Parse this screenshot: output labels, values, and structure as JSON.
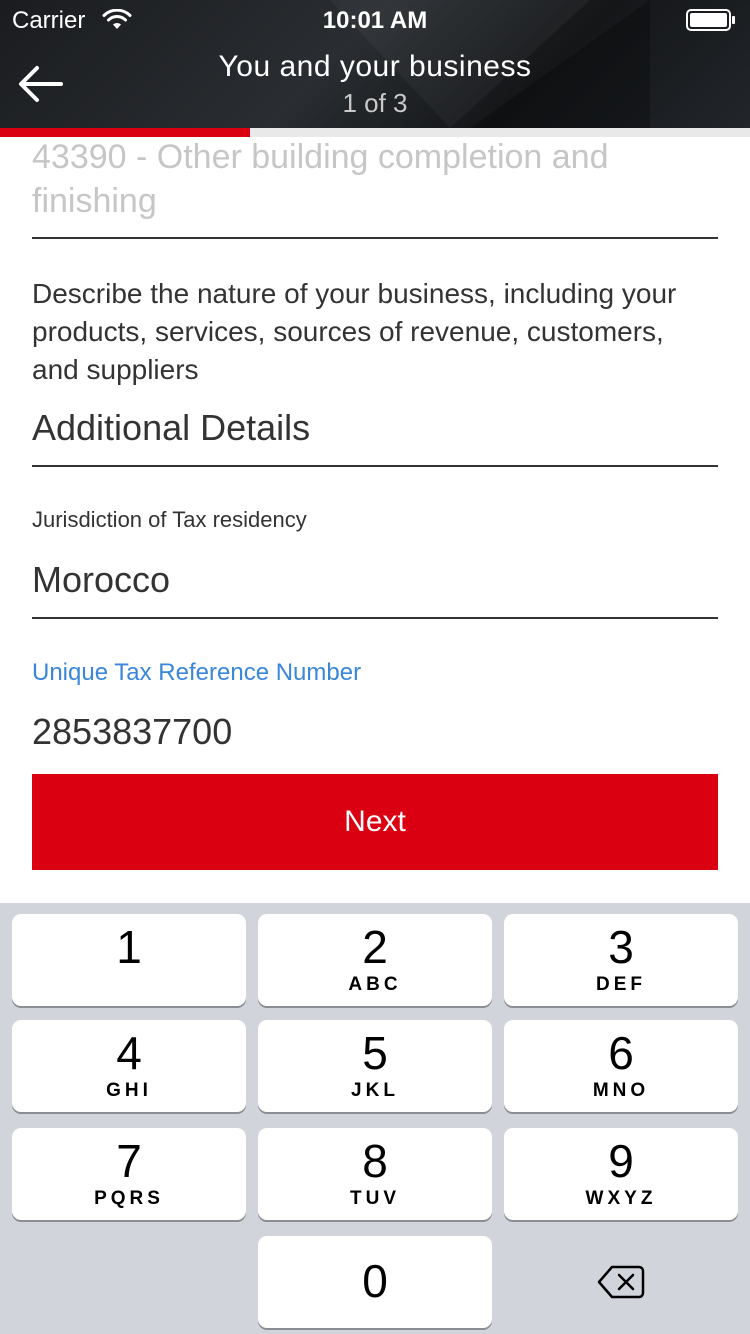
{
  "status_bar": {
    "carrier": "Carrier",
    "time": "10:01 AM",
    "icons": [
      "wifi-icon",
      "battery-icon"
    ]
  },
  "header": {
    "title": "You and your business",
    "step": "1 of 3",
    "back_icon": "arrow-left-icon"
  },
  "progress": {
    "fraction": 0.333,
    "fill_color": "#db0011"
  },
  "form": {
    "industry_value": "43390 - Other building completion and finishing",
    "describe_label": "Describe the nature of your business, including your products, services, sources of revenue, customers, and suppliers",
    "additional_details_value": "Additional Details",
    "tax_residency_label": "Jurisdiction of Tax residency",
    "tax_residency_value": "Morocco",
    "utr_label": "Unique Tax Reference Number",
    "utr_value": "2853837700",
    "next_label": "Next"
  },
  "keypad": {
    "keys": [
      {
        "digit": "1",
        "letters": ""
      },
      {
        "digit": "2",
        "letters": "ABC"
      },
      {
        "digit": "3",
        "letters": "DEF"
      },
      {
        "digit": "4",
        "letters": "GHI"
      },
      {
        "digit": "5",
        "letters": "JKL"
      },
      {
        "digit": "6",
        "letters": "MNO"
      },
      {
        "digit": "7",
        "letters": "PQRS"
      },
      {
        "digit": "8",
        "letters": "TUV"
      },
      {
        "digit": "9",
        "letters": "WXYZ"
      },
      {
        "digit": "0",
        "letters": ""
      }
    ],
    "delete_icon": "backspace-icon"
  },
  "colors": {
    "accent": "#db0011",
    "link": "#3a86d9",
    "header_bg": "#1e2024",
    "keypad_bg": "#d1d4da"
  }
}
